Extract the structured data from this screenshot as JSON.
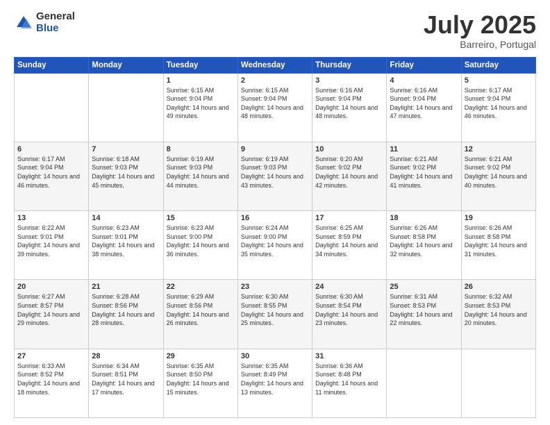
{
  "logo": {
    "general": "General",
    "blue": "Blue"
  },
  "header": {
    "month": "July 2025",
    "location": "Barreiro, Portugal"
  },
  "days_of_week": [
    "Sunday",
    "Monday",
    "Tuesday",
    "Wednesday",
    "Thursday",
    "Friday",
    "Saturday"
  ],
  "weeks": [
    [
      {
        "day": "",
        "info": ""
      },
      {
        "day": "",
        "info": ""
      },
      {
        "day": "1",
        "info": "Sunrise: 6:15 AM\nSunset: 9:04 PM\nDaylight: 14 hours and 49 minutes."
      },
      {
        "day": "2",
        "info": "Sunrise: 6:15 AM\nSunset: 9:04 PM\nDaylight: 14 hours and 48 minutes."
      },
      {
        "day": "3",
        "info": "Sunrise: 6:16 AM\nSunset: 9:04 PM\nDaylight: 14 hours and 48 minutes."
      },
      {
        "day": "4",
        "info": "Sunrise: 6:16 AM\nSunset: 9:04 PM\nDaylight: 14 hours and 47 minutes."
      },
      {
        "day": "5",
        "info": "Sunrise: 6:17 AM\nSunset: 9:04 PM\nDaylight: 14 hours and 46 minutes."
      }
    ],
    [
      {
        "day": "6",
        "info": "Sunrise: 6:17 AM\nSunset: 9:04 PM\nDaylight: 14 hours and 46 minutes."
      },
      {
        "day": "7",
        "info": "Sunrise: 6:18 AM\nSunset: 9:03 PM\nDaylight: 14 hours and 45 minutes."
      },
      {
        "day": "8",
        "info": "Sunrise: 6:19 AM\nSunset: 9:03 PM\nDaylight: 14 hours and 44 minutes."
      },
      {
        "day": "9",
        "info": "Sunrise: 6:19 AM\nSunset: 9:03 PM\nDaylight: 14 hours and 43 minutes."
      },
      {
        "day": "10",
        "info": "Sunrise: 6:20 AM\nSunset: 9:02 PM\nDaylight: 14 hours and 42 minutes."
      },
      {
        "day": "11",
        "info": "Sunrise: 6:21 AM\nSunset: 9:02 PM\nDaylight: 14 hours and 41 minutes."
      },
      {
        "day": "12",
        "info": "Sunrise: 6:21 AM\nSunset: 9:02 PM\nDaylight: 14 hours and 40 minutes."
      }
    ],
    [
      {
        "day": "13",
        "info": "Sunrise: 6:22 AM\nSunset: 9:01 PM\nDaylight: 14 hours and 39 minutes."
      },
      {
        "day": "14",
        "info": "Sunrise: 6:23 AM\nSunset: 9:01 PM\nDaylight: 14 hours and 38 minutes."
      },
      {
        "day": "15",
        "info": "Sunrise: 6:23 AM\nSunset: 9:00 PM\nDaylight: 14 hours and 36 minutes."
      },
      {
        "day": "16",
        "info": "Sunrise: 6:24 AM\nSunset: 9:00 PM\nDaylight: 14 hours and 35 minutes."
      },
      {
        "day": "17",
        "info": "Sunrise: 6:25 AM\nSunset: 8:59 PM\nDaylight: 14 hours and 34 minutes."
      },
      {
        "day": "18",
        "info": "Sunrise: 6:26 AM\nSunset: 8:58 PM\nDaylight: 14 hours and 32 minutes."
      },
      {
        "day": "19",
        "info": "Sunrise: 6:26 AM\nSunset: 8:58 PM\nDaylight: 14 hours and 31 minutes."
      }
    ],
    [
      {
        "day": "20",
        "info": "Sunrise: 6:27 AM\nSunset: 8:57 PM\nDaylight: 14 hours and 29 minutes."
      },
      {
        "day": "21",
        "info": "Sunrise: 6:28 AM\nSunset: 8:56 PM\nDaylight: 14 hours and 28 minutes."
      },
      {
        "day": "22",
        "info": "Sunrise: 6:29 AM\nSunset: 8:56 PM\nDaylight: 14 hours and 26 minutes."
      },
      {
        "day": "23",
        "info": "Sunrise: 6:30 AM\nSunset: 8:55 PM\nDaylight: 14 hours and 25 minutes."
      },
      {
        "day": "24",
        "info": "Sunrise: 6:30 AM\nSunset: 8:54 PM\nDaylight: 14 hours and 23 minutes."
      },
      {
        "day": "25",
        "info": "Sunrise: 6:31 AM\nSunset: 8:53 PM\nDaylight: 14 hours and 22 minutes."
      },
      {
        "day": "26",
        "info": "Sunrise: 6:32 AM\nSunset: 8:53 PM\nDaylight: 14 hours and 20 minutes."
      }
    ],
    [
      {
        "day": "27",
        "info": "Sunrise: 6:33 AM\nSunset: 8:52 PM\nDaylight: 14 hours and 18 minutes."
      },
      {
        "day": "28",
        "info": "Sunrise: 6:34 AM\nSunset: 8:51 PM\nDaylight: 14 hours and 17 minutes."
      },
      {
        "day": "29",
        "info": "Sunrise: 6:35 AM\nSunset: 8:50 PM\nDaylight: 14 hours and 15 minutes."
      },
      {
        "day": "30",
        "info": "Sunrise: 6:35 AM\nSunset: 8:49 PM\nDaylight: 14 hours and 13 minutes."
      },
      {
        "day": "31",
        "info": "Sunrise: 6:36 AM\nSunset: 8:48 PM\nDaylight: 14 hours and 11 minutes."
      },
      {
        "day": "",
        "info": ""
      },
      {
        "day": "",
        "info": ""
      }
    ]
  ]
}
